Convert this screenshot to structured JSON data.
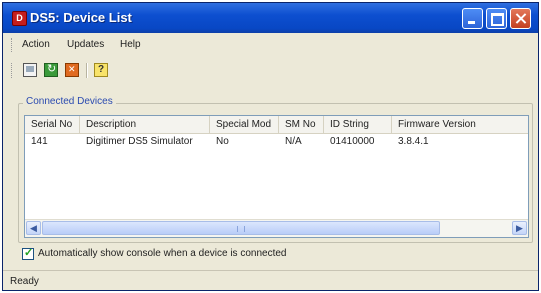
{
  "window": {
    "title": "DS5: Device List",
    "app_icon_glyph": "D",
    "colors": {
      "titlebar": "#0847c4",
      "group_label": "#2a4ab0",
      "check": "#21a121"
    }
  },
  "menu": [
    "Action",
    "Updates",
    "Help"
  ],
  "toolbar": {
    "icons": [
      "console-icon",
      "refresh-icon",
      "remove-device-icon",
      "help-icon"
    ]
  },
  "devices": {
    "group_label": "Connected Devices",
    "columns": [
      "Serial No",
      "Description",
      "Special Mod",
      "SM No",
      "ID String",
      "Firmware Version"
    ],
    "rows": [
      [
        "141",
        "Digitimer DS5 Simulator",
        "No",
        "N/A",
        "01410000",
        "3.8.4.1"
      ]
    ]
  },
  "options": {
    "auto_console_label": "Automatically show console when a device is connected",
    "auto_console_checked": true
  },
  "status": {
    "text": "Ready"
  }
}
